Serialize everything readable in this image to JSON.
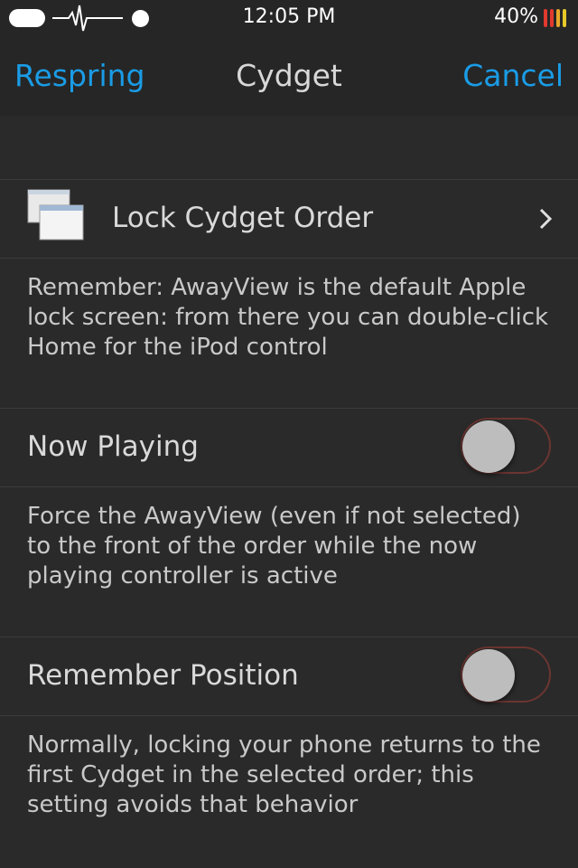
{
  "status_bar": {
    "time": "12:05 PM",
    "battery_percent": "40%",
    "battery_colors": [
      "#e03a2e",
      "#e03a2e",
      "#e8a62a",
      "#e8c92a"
    ]
  },
  "nav": {
    "left_button": "Respring",
    "title": "Cydget",
    "right_button": "Cancel",
    "accent_color": "#1a9ce6"
  },
  "rows": {
    "lock_order": {
      "label": "Lock Cydget Order",
      "icon": "windows-icon",
      "description": "Remember: AwayView is the default Apple lock screen: from there you can double-click Home for the iPod control"
    },
    "now_playing": {
      "label": "Now Playing",
      "toggle_on": false,
      "description": "Force the AwayView (even if not selected) to the front of the order while the now playing controller is active"
    },
    "remember_position": {
      "label": "Remember Position",
      "toggle_on": false,
      "description": "Normally, locking your phone returns to the first Cydget in the selected order; this setting avoids that behavior"
    }
  }
}
